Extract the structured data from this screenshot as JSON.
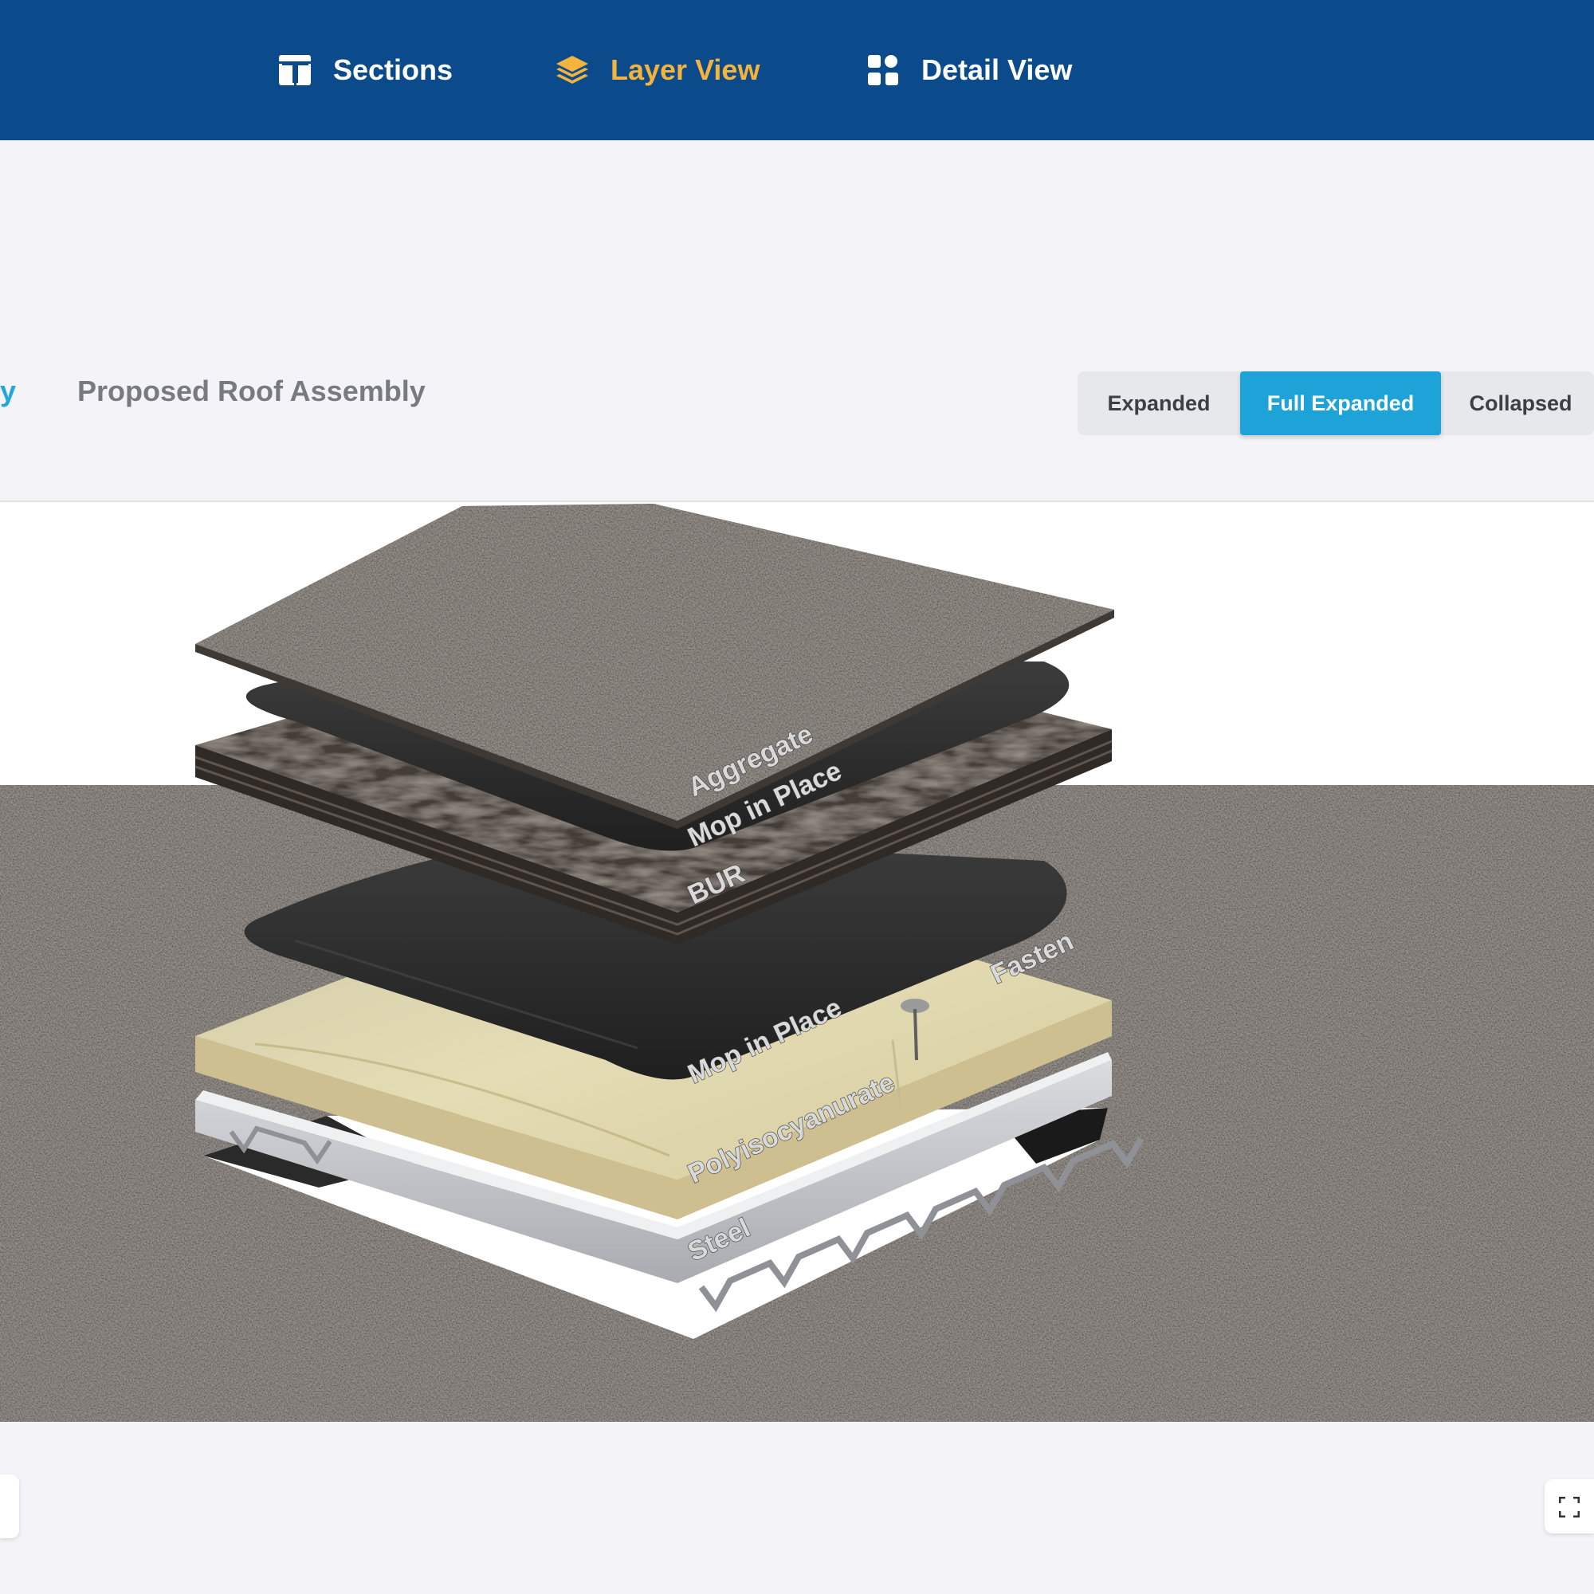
{
  "nav": {
    "items": [
      {
        "label": "Sections",
        "icon": "sections-icon",
        "active": false
      },
      {
        "label": "Layer View",
        "icon": "layers-icon",
        "active": true
      },
      {
        "label": "Detail View",
        "icon": "grid-icon",
        "active": false
      }
    ],
    "background_color": "#0b4b8c",
    "active_color": "#f3b33d"
  },
  "header": {
    "partial_link_text": "y",
    "title": "Proposed Roof Assembly"
  },
  "view_toggle": {
    "options": [
      "Expanded",
      "Full Expanded",
      "Collapsed"
    ],
    "selected": "Full Expanded",
    "accent_color": "#1ea3d9"
  },
  "viewer": {
    "layers": [
      {
        "label": "Aggregate"
      },
      {
        "label": "Mop in Place"
      },
      {
        "label": "BUR"
      },
      {
        "label": "Fasten"
      },
      {
        "label": "Mop in Place"
      },
      {
        "label": "Polyisocyanurate"
      },
      {
        "label": "Steel"
      }
    ],
    "fullscreen_icon": "fullscreen-icon"
  }
}
